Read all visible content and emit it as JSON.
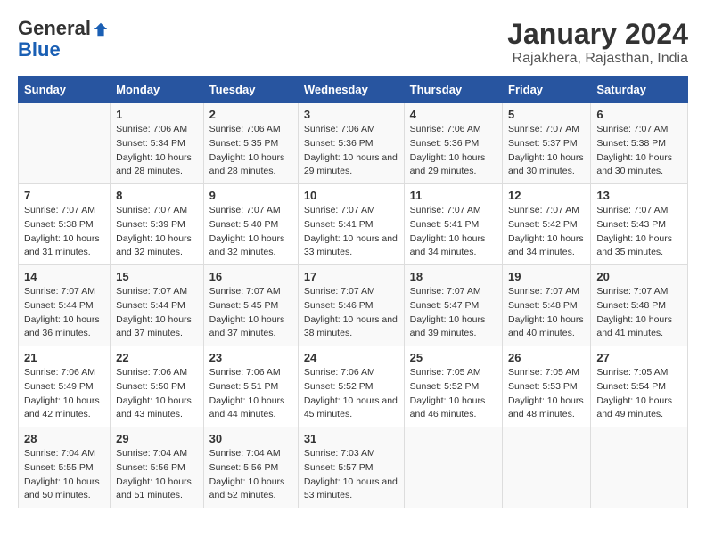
{
  "logo": {
    "general": "General",
    "blue": "Blue"
  },
  "title": "January 2024",
  "subtitle": "Rajakhera, Rajasthan, India",
  "headers": [
    "Sunday",
    "Monday",
    "Tuesday",
    "Wednesday",
    "Thursday",
    "Friday",
    "Saturday"
  ],
  "weeks": [
    [
      {
        "day": "",
        "sunrise": "",
        "sunset": "",
        "daylight": ""
      },
      {
        "day": "1",
        "sunrise": "Sunrise: 7:06 AM",
        "sunset": "Sunset: 5:34 PM",
        "daylight": "Daylight: 10 hours and 28 minutes."
      },
      {
        "day": "2",
        "sunrise": "Sunrise: 7:06 AM",
        "sunset": "Sunset: 5:35 PM",
        "daylight": "Daylight: 10 hours and 28 minutes."
      },
      {
        "day": "3",
        "sunrise": "Sunrise: 7:06 AM",
        "sunset": "Sunset: 5:36 PM",
        "daylight": "Daylight: 10 hours and 29 minutes."
      },
      {
        "day": "4",
        "sunrise": "Sunrise: 7:06 AM",
        "sunset": "Sunset: 5:36 PM",
        "daylight": "Daylight: 10 hours and 29 minutes."
      },
      {
        "day": "5",
        "sunrise": "Sunrise: 7:07 AM",
        "sunset": "Sunset: 5:37 PM",
        "daylight": "Daylight: 10 hours and 30 minutes."
      },
      {
        "day": "6",
        "sunrise": "Sunrise: 7:07 AM",
        "sunset": "Sunset: 5:38 PM",
        "daylight": "Daylight: 10 hours and 30 minutes."
      }
    ],
    [
      {
        "day": "7",
        "sunrise": "Sunrise: 7:07 AM",
        "sunset": "Sunset: 5:38 PM",
        "daylight": "Daylight: 10 hours and 31 minutes."
      },
      {
        "day": "8",
        "sunrise": "Sunrise: 7:07 AM",
        "sunset": "Sunset: 5:39 PM",
        "daylight": "Daylight: 10 hours and 32 minutes."
      },
      {
        "day": "9",
        "sunrise": "Sunrise: 7:07 AM",
        "sunset": "Sunset: 5:40 PM",
        "daylight": "Daylight: 10 hours and 32 minutes."
      },
      {
        "day": "10",
        "sunrise": "Sunrise: 7:07 AM",
        "sunset": "Sunset: 5:41 PM",
        "daylight": "Daylight: 10 hours and 33 minutes."
      },
      {
        "day": "11",
        "sunrise": "Sunrise: 7:07 AM",
        "sunset": "Sunset: 5:41 PM",
        "daylight": "Daylight: 10 hours and 34 minutes."
      },
      {
        "day": "12",
        "sunrise": "Sunrise: 7:07 AM",
        "sunset": "Sunset: 5:42 PM",
        "daylight": "Daylight: 10 hours and 34 minutes."
      },
      {
        "day": "13",
        "sunrise": "Sunrise: 7:07 AM",
        "sunset": "Sunset: 5:43 PM",
        "daylight": "Daylight: 10 hours and 35 minutes."
      }
    ],
    [
      {
        "day": "14",
        "sunrise": "Sunrise: 7:07 AM",
        "sunset": "Sunset: 5:44 PM",
        "daylight": "Daylight: 10 hours and 36 minutes."
      },
      {
        "day": "15",
        "sunrise": "Sunrise: 7:07 AM",
        "sunset": "Sunset: 5:44 PM",
        "daylight": "Daylight: 10 hours and 37 minutes."
      },
      {
        "day": "16",
        "sunrise": "Sunrise: 7:07 AM",
        "sunset": "Sunset: 5:45 PM",
        "daylight": "Daylight: 10 hours and 37 minutes."
      },
      {
        "day": "17",
        "sunrise": "Sunrise: 7:07 AM",
        "sunset": "Sunset: 5:46 PM",
        "daylight": "Daylight: 10 hours and 38 minutes."
      },
      {
        "day": "18",
        "sunrise": "Sunrise: 7:07 AM",
        "sunset": "Sunset: 5:47 PM",
        "daylight": "Daylight: 10 hours and 39 minutes."
      },
      {
        "day": "19",
        "sunrise": "Sunrise: 7:07 AM",
        "sunset": "Sunset: 5:48 PM",
        "daylight": "Daylight: 10 hours and 40 minutes."
      },
      {
        "day": "20",
        "sunrise": "Sunrise: 7:07 AM",
        "sunset": "Sunset: 5:48 PM",
        "daylight": "Daylight: 10 hours and 41 minutes."
      }
    ],
    [
      {
        "day": "21",
        "sunrise": "Sunrise: 7:06 AM",
        "sunset": "Sunset: 5:49 PM",
        "daylight": "Daylight: 10 hours and 42 minutes."
      },
      {
        "day": "22",
        "sunrise": "Sunrise: 7:06 AM",
        "sunset": "Sunset: 5:50 PM",
        "daylight": "Daylight: 10 hours and 43 minutes."
      },
      {
        "day": "23",
        "sunrise": "Sunrise: 7:06 AM",
        "sunset": "Sunset: 5:51 PM",
        "daylight": "Daylight: 10 hours and 44 minutes."
      },
      {
        "day": "24",
        "sunrise": "Sunrise: 7:06 AM",
        "sunset": "Sunset: 5:52 PM",
        "daylight": "Daylight: 10 hours and 45 minutes."
      },
      {
        "day": "25",
        "sunrise": "Sunrise: 7:05 AM",
        "sunset": "Sunset: 5:52 PM",
        "daylight": "Daylight: 10 hours and 46 minutes."
      },
      {
        "day": "26",
        "sunrise": "Sunrise: 7:05 AM",
        "sunset": "Sunset: 5:53 PM",
        "daylight": "Daylight: 10 hours and 48 minutes."
      },
      {
        "day": "27",
        "sunrise": "Sunrise: 7:05 AM",
        "sunset": "Sunset: 5:54 PM",
        "daylight": "Daylight: 10 hours and 49 minutes."
      }
    ],
    [
      {
        "day": "28",
        "sunrise": "Sunrise: 7:04 AM",
        "sunset": "Sunset: 5:55 PM",
        "daylight": "Daylight: 10 hours and 50 minutes."
      },
      {
        "day": "29",
        "sunrise": "Sunrise: 7:04 AM",
        "sunset": "Sunset: 5:56 PM",
        "daylight": "Daylight: 10 hours and 51 minutes."
      },
      {
        "day": "30",
        "sunrise": "Sunrise: 7:04 AM",
        "sunset": "Sunset: 5:56 PM",
        "daylight": "Daylight: 10 hours and 52 minutes."
      },
      {
        "day": "31",
        "sunrise": "Sunrise: 7:03 AM",
        "sunset": "Sunset: 5:57 PM",
        "daylight": "Daylight: 10 hours and 53 minutes."
      },
      {
        "day": "",
        "sunrise": "",
        "sunset": "",
        "daylight": ""
      },
      {
        "day": "",
        "sunrise": "",
        "sunset": "",
        "daylight": ""
      },
      {
        "day": "",
        "sunrise": "",
        "sunset": "",
        "daylight": ""
      }
    ]
  ]
}
